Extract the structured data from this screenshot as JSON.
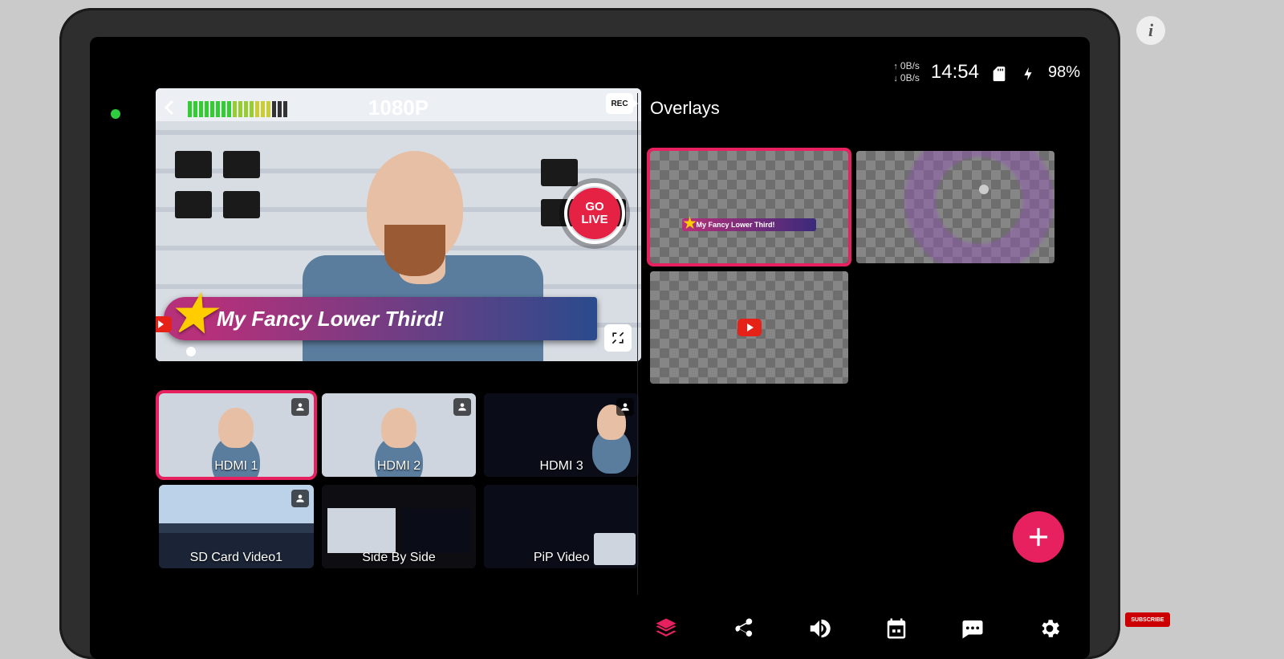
{
  "status": {
    "net_up": "0B/s",
    "net_down": "0B/s",
    "clock": "14:54",
    "battery": "98%"
  },
  "preview": {
    "resolution": "1080P",
    "rec_label": "REC",
    "go_live": "GO\nLIVE",
    "lower_third_text": "My Fancy Lower Third!"
  },
  "sources": [
    {
      "label": "HDMI 1",
      "thumb": "person-sm",
      "selected": true,
      "badge": true
    },
    {
      "label": "HDMI 2",
      "thumb": "person-sm",
      "selected": false,
      "badge": true
    },
    {
      "label": "HDMI 3",
      "thumb": "dark",
      "selected": false,
      "badge": true
    },
    {
      "label": "SD Card Video1",
      "thumb": "city",
      "selected": false,
      "badge": true
    },
    {
      "label": "Side By Side",
      "thumb": "split",
      "selected": false,
      "badge": false
    },
    {
      "label": "PiP Video",
      "thumb": "pip",
      "selected": false,
      "badge": false
    }
  ],
  "overlays": {
    "title": "Overlays",
    "items": [
      {
        "kind": "lower-third",
        "mini_text": "My Fancy Lower Third!",
        "selected": true
      },
      {
        "kind": "lens-flare",
        "selected": false
      },
      {
        "kind": "youtube-bug",
        "selected": false
      }
    ]
  },
  "tabs": [
    "layers",
    "share",
    "audio",
    "schedule",
    "chat",
    "settings"
  ],
  "external": {
    "info": "i",
    "subscribe": "SUBSCRIBE"
  }
}
